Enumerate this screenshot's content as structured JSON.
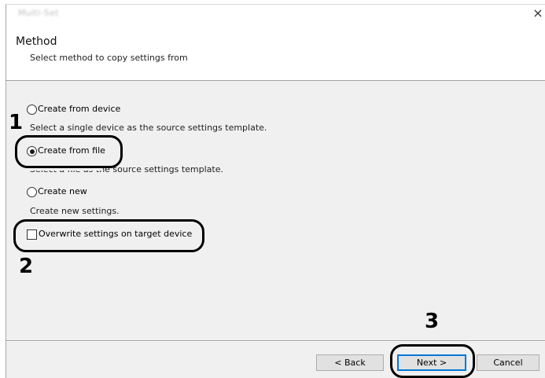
{
  "window": {
    "title": "Multi-Set",
    "close_glyph": "×"
  },
  "header": {
    "title": "Method",
    "subtitle": "Select method to copy settings from"
  },
  "options": [
    {
      "label": "Create from device",
      "description": "Select a single device as the source settings template.",
      "selected": false
    },
    {
      "label": "Create from file",
      "description": "Select a file as the source settings template.",
      "selected": true
    },
    {
      "label": "Create new",
      "description": "Create new settings.",
      "selected": false
    }
  ],
  "overwrite_checkbox": {
    "label": "Overwrite settings on target device",
    "checked": false
  },
  "footer": {
    "back_label": "< Back",
    "next_label": "Next >",
    "cancel_label": "Cancel"
  },
  "callouts": {
    "step1": "1",
    "step2": "2",
    "step3": "3"
  },
  "colors": {
    "panel_bg": "#f0f0f0",
    "button_bg": "#e1e1e1",
    "default_button_border": "#0078d7",
    "callout_stroke": "#000000"
  },
  "icons": {
    "close": "close-icon",
    "radio": "radio-button-icon",
    "checkbox": "checkbox-icon"
  }
}
